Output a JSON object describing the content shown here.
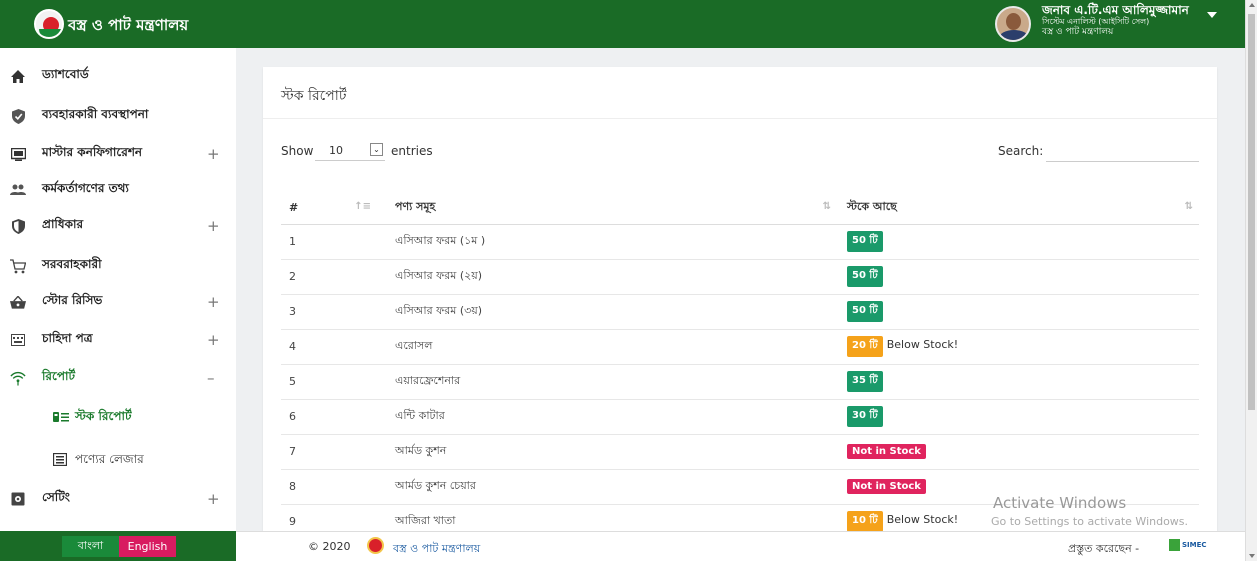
{
  "header": {
    "brand": "বস্ত্র ও পাট মন্ত্রণালয়",
    "user_name": "জনাব এ.টি.এম আলিমুজ্জামান",
    "user_role": "সিস্টেম এনালিস্ট (আইসিটি সেল)",
    "user_office": "বস্ত্র ও পাট মন্ত্রণালয়"
  },
  "sidebar": {
    "items": [
      {
        "label": "ড্যাশবোর্ড",
        "icon": "home-icon",
        "plus": ""
      },
      {
        "label": "ব্যবহারকারী ব্যবস্থাপনা",
        "icon": "shield-check-icon",
        "plus": ""
      },
      {
        "label": "মাস্টার কনফিগারেশন",
        "icon": "monitor-icon",
        "plus": "+"
      },
      {
        "label": "কর্মকর্তাগণের তথ্য",
        "icon": "people-icon",
        "plus": ""
      },
      {
        "label": "প্রাধিকার",
        "icon": "shield-icon",
        "plus": "+"
      },
      {
        "label": "সরবরাহকারী",
        "icon": "cart-icon",
        "plus": ""
      },
      {
        "label": "স্টোর রিসিভ",
        "icon": "basket-icon",
        "plus": "+"
      },
      {
        "label": "চাহিদা পত্র",
        "icon": "keyboard-icon",
        "plus": "+"
      },
      {
        "label": "রিপোর্ট",
        "icon": "wifi-icon",
        "plus": "–"
      }
    ],
    "sub": [
      {
        "label": "স্টক রিপোর্ট",
        "icon": "list-icon"
      },
      {
        "label": "পণ্যের লেজার",
        "icon": "ledger-icon"
      }
    ],
    "settings": {
      "label": "সেটিং",
      "icon": "gear-icon",
      "plus": "+"
    },
    "lang_bn": "বাংলা",
    "lang_en": "English"
  },
  "main": {
    "title": "স্টক রিপোর্ট",
    "show": "Show",
    "page_size": "10",
    "entries": "entries",
    "search_label": "Search:",
    "columns": [
      "#",
      "পণ্য সমূহ",
      "স্টকে আছে"
    ],
    "rows": [
      {
        "n": "1",
        "product": "এসিআর ফরম (১ম )",
        "stock": "50 টি",
        "color": "#1a9a6a",
        "note": ""
      },
      {
        "n": "2",
        "product": "এসিআর ফরম (২য়)",
        "stock": "50 টি",
        "color": "#1a9a6a",
        "note": ""
      },
      {
        "n": "3",
        "product": "এসিআর ফরম (৩য়)",
        "stock": "50 টি",
        "color": "#1a9a6a",
        "note": ""
      },
      {
        "n": "4",
        "product": "এরোসল",
        "stock": "20 টি",
        "color": "#f5a21a",
        "note": "Below Stock!"
      },
      {
        "n": "5",
        "product": "এয়ারফ্রেশেনার",
        "stock": "35 টি",
        "color": "#1a9a6a",
        "note": ""
      },
      {
        "n": "6",
        "product": "এন্টি কাটার",
        "stock": "30 টি",
        "color": "#1a9a6a",
        "note": ""
      },
      {
        "n": "7",
        "product": "আর্মড কুশন",
        "stock": "Not in Stock",
        "color": "#e0245e",
        "note": ""
      },
      {
        "n": "8",
        "product": "আর্মড কুশন চেয়ার",
        "stock": "Not in Stock",
        "color": "#e0245e",
        "note": ""
      },
      {
        "n": "9",
        "product": "আজিরা খাতা",
        "stock": "10 টি",
        "color": "#f5a21a",
        "note": "Below Stock!"
      }
    ]
  },
  "footer": {
    "copyright": "© 2020",
    "ministry": "বস্ত্র ও পাট মন্ত্রণালয়",
    "made_by": "প্রস্তুত করেছেন -",
    "vendor": "SIMEC"
  },
  "watermark": {
    "line1": "Activate Windows",
    "line2": "Go to Settings to activate Windows."
  }
}
